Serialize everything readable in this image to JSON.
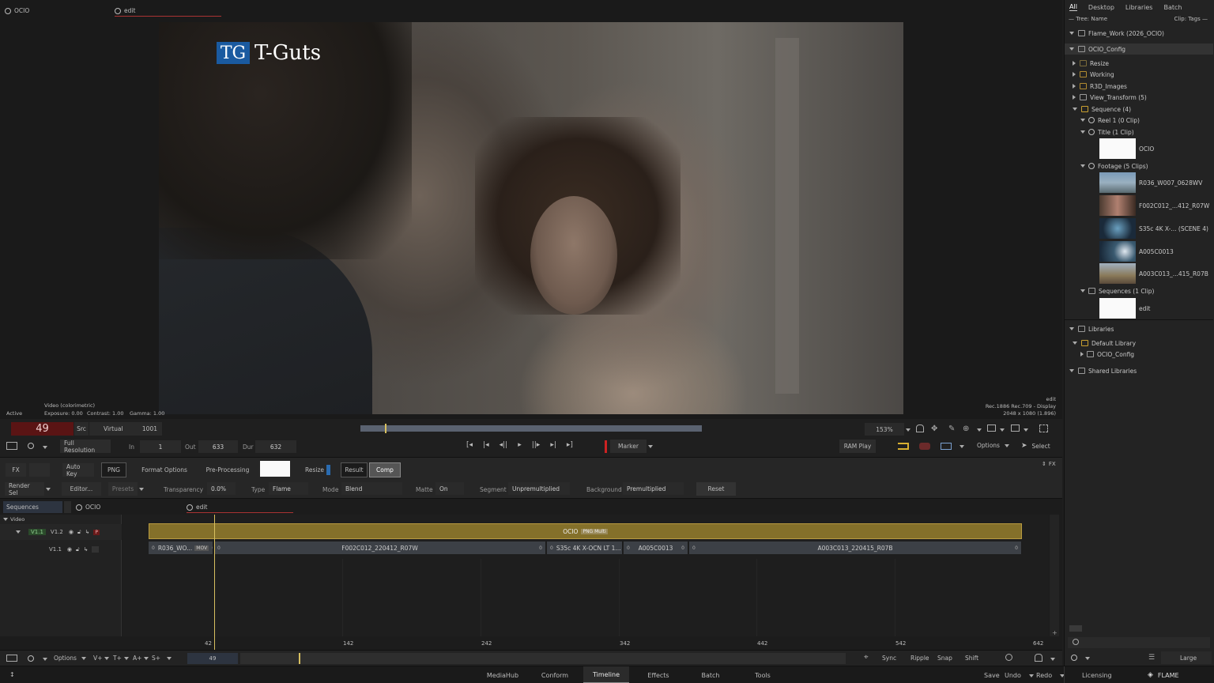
{
  "viewer": {
    "tab_left": "OCIO",
    "tab_right": "edit",
    "state": "Active",
    "video_label": "Video (colorimetric)",
    "exposure": "Exposure: 0.00",
    "contrast": "Contrast: 1.00",
    "gamma": "Gamma: 1.00",
    "info_clip": "edit",
    "info_display": "Rec.1886 Rec.709 - Display",
    "info_res": "2048 x 1080 (1.896)",
    "logo_mark": "TG",
    "logo_text": "T-Guts"
  },
  "transport": {
    "frame": "49",
    "src_label": "Src",
    "virtual_label": "Virtual",
    "virtual_value": "1001",
    "resolution": "Full Resolution",
    "in_label": "In",
    "in_value": "1",
    "out_label": "Out",
    "out_value": "633",
    "dur_label": "Dur",
    "dur_value": "632",
    "marker": "Marker",
    "zoom": "153%",
    "ram_play": "RAM Play",
    "options": "Options",
    "select": "Select"
  },
  "tools": {
    "fx": "FX",
    "auto_key": "Auto Key",
    "png": "PNG",
    "format_options": "Format Options",
    "pre_processing": "Pre-Processing",
    "resize": "Resize",
    "result": "Result",
    "comp": "Comp",
    "fx_right": "FX",
    "render_sel": "Render Sel",
    "editor": "Editor...",
    "presets": "Presets",
    "transparency_label": "Transparency",
    "transparency_value": "0.0%",
    "type_label": "Type",
    "type_value": "Flame",
    "mode_label": "Mode",
    "mode_value": "Blend",
    "matte_label": "Matte",
    "matte_value": "On",
    "segment_label": "Segment",
    "segment_value": "Unpremultiplied",
    "background_label": "Background",
    "background_value": "Premultiplied",
    "reset": "Reset"
  },
  "timeline": {
    "sequences_tab": "Sequences",
    "tab_ocio": "OCIO",
    "tab_edit": "edit",
    "video_label": "Video",
    "track_v12_label": "V1.1",
    "track_v12_name": "V1.2",
    "track_v11_name": "V1.1",
    "p_badge": "P",
    "title_clip": "OCIO",
    "title_clip_tag": "PNG Multi",
    "clips": [
      {
        "name": "R036_WO...",
        "tag": "MOV",
        "in": "0",
        "out": "0"
      },
      {
        "name": "F002C012_220412_R07W",
        "in": "0",
        "out": "0"
      },
      {
        "name": "S35c 4K X-OCN LT 1...",
        "in": "0",
        "out": "0"
      },
      {
        "name": "A005C0013",
        "in": "0",
        "out": "0"
      },
      {
        "name": "A003C013_220415_R07B",
        "in": "0",
        "out": "0"
      }
    ],
    "ruler": [
      "42",
      "142",
      "242",
      "342",
      "442",
      "542",
      "642"
    ],
    "bar_frame": "49",
    "options": "Options",
    "v_plus": "V+",
    "t_plus": "T+",
    "a_plus": "A+",
    "s_plus": "S+",
    "sync": "Sync",
    "ripple": "Ripple",
    "snap": "Snap",
    "shift": "Shift"
  },
  "status": {
    "tabs": [
      "MediaHub",
      "Conform",
      "Timeline",
      "Effects",
      "Batch",
      "Tools"
    ],
    "active_tab": "Timeline",
    "save": "Save",
    "undo": "Undo",
    "redo": "Redo",
    "licensing": "Licensing",
    "brand": "FLAME",
    "large": "Large"
  },
  "library": {
    "tabs": [
      "All",
      "Desktop",
      "Libraries",
      "Batch"
    ],
    "tree_label": "— Tree: Name",
    "clip_label": "Clip: Tags —",
    "rows": [
      {
        "label": "Flame_Work (2026_OCIO)",
        "indent": 0
      },
      {
        "label": "OCIO_Config",
        "indent": 0
      },
      {
        "label": "Resize",
        "indent": 1
      },
      {
        "label": "Working",
        "indent": 1
      },
      {
        "label": "R3D_Images",
        "indent": 1
      },
      {
        "label": "View_Transform (5)",
        "indent": 1
      },
      {
        "label": "Sequence (4)",
        "indent": 1
      },
      {
        "label": "Reel 1 (0 Clip)",
        "indent": 2
      },
      {
        "label": "Title (1 Clip)",
        "indent": 2
      }
    ],
    "title_clip": "OCIO",
    "footage_label": "Footage (5 Clips)",
    "footage": [
      "R036_W007_0628WV",
      "F002C012_...412_R07W",
      "S35c 4K X-... (SCENE 4)",
      "A005C0013",
      "A003C013_...415_R07B"
    ],
    "sequences_label": "Sequences (1 Clip)",
    "seq_clip": "edit",
    "libraries_label": "Libraries",
    "default_library": "Default Library",
    "default_child": "OCIO_Config",
    "shared_libraries": "Shared Libraries"
  }
}
